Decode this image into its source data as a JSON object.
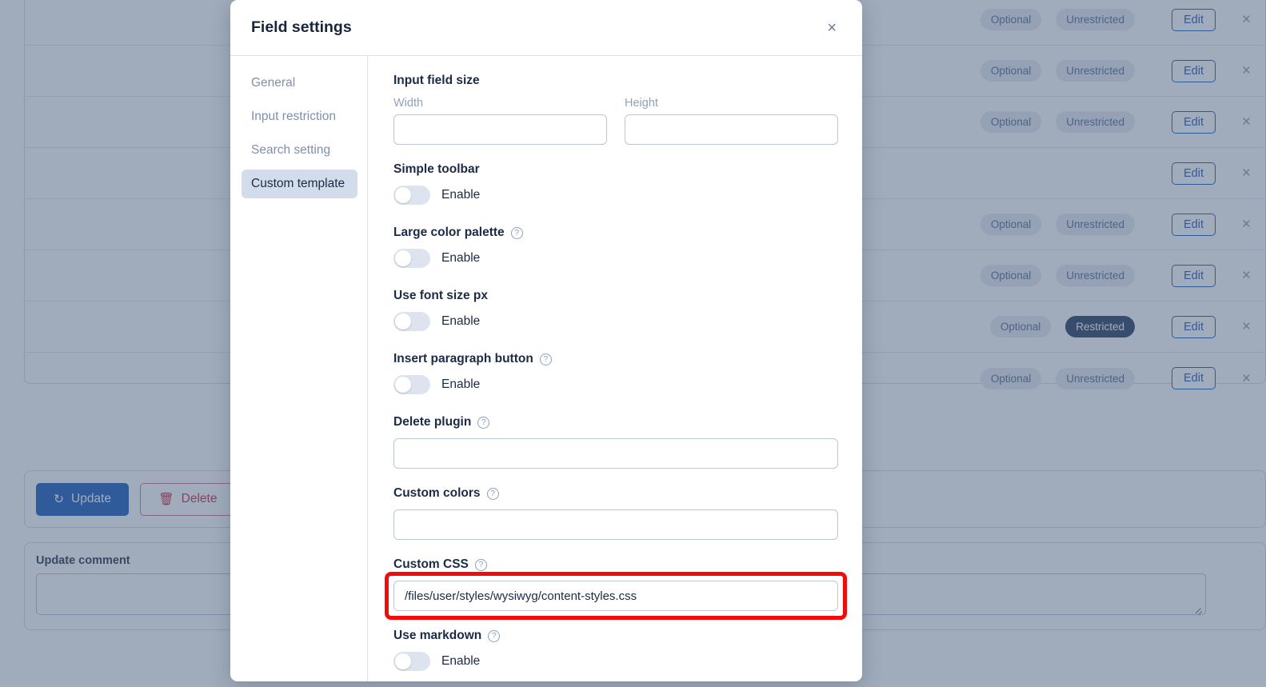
{
  "background": {
    "table_rows": [
      {
        "badges": [
          "Optional",
          "Unrestricted"
        ],
        "edit_label": "Edit",
        "close_icon": "×"
      },
      {
        "badges": [
          "Optional",
          "Unrestricted"
        ],
        "edit_label": "Edit",
        "close_icon": "×"
      },
      {
        "badges": [
          "Optional",
          "Unrestricted"
        ],
        "edit_label": "Edit",
        "close_icon": "×"
      },
      {
        "badges": [
          "",
          ""
        ],
        "edit_label": "Edit",
        "close_icon": "×"
      },
      {
        "badges": [
          "Optional",
          "Unrestricted"
        ],
        "edit_label": "Edit",
        "close_icon": "×"
      },
      {
        "badges": [
          "Optional",
          "Unrestricted"
        ],
        "edit_label": "Edit",
        "close_icon": "×"
      },
      {
        "badges": [
          "Optional",
          "Restricted"
        ],
        "edit_label": "Edit",
        "close_icon": "×"
      },
      {
        "badges": [
          "Optional",
          "Unrestricted"
        ],
        "edit_label": "Edit",
        "close_icon": "×"
      }
    ],
    "actions": {
      "update_label": "Update",
      "update_icon": "↻",
      "delete_label": "Delete",
      "delete_icon": "🗑"
    },
    "comment": {
      "label": "Update comment",
      "value": "",
      "placeholder": ""
    },
    "colors": {
      "primary": "#1f5fbf",
      "danger": "#c4314b",
      "badge_restricted_bg": "#2f4263",
      "overlay": "#8694a5"
    }
  },
  "modal": {
    "title": "Field settings",
    "close_icon": "×",
    "sidebar": {
      "items": [
        {
          "label": "General",
          "active": false
        },
        {
          "label": "Input restriction",
          "active": false
        },
        {
          "label": "Search setting",
          "active": false
        },
        {
          "label": "Custom template",
          "active": true
        }
      ]
    },
    "main": {
      "input_field_size": {
        "title": "Input field size",
        "width": {
          "label": "Width",
          "value": "",
          "placeholder": ""
        },
        "height": {
          "label": "Height",
          "value": "",
          "placeholder": ""
        }
      },
      "toggles": [
        {
          "title": "Simple toolbar",
          "has_help": false,
          "help_icon": "?",
          "enable_label": "Enable",
          "enabled": false
        },
        {
          "title": "Large color palette",
          "has_help": true,
          "help_icon": "?",
          "enable_label": "Enable",
          "enabled": false
        },
        {
          "title": "Use font size px",
          "has_help": false,
          "help_icon": "?",
          "enable_label": "Enable",
          "enabled": false
        },
        {
          "title": "Insert paragraph button",
          "has_help": true,
          "help_icon": "?",
          "enable_label": "Enable",
          "enabled": false
        }
      ],
      "delete_plugin": {
        "title": "Delete plugin",
        "help_icon": "?",
        "value": "",
        "placeholder": ""
      },
      "custom_colors": {
        "title": "Custom colors",
        "help_icon": "?",
        "value": "",
        "placeholder": ""
      },
      "custom_css": {
        "title": "Custom CSS",
        "help_icon": "?",
        "value": "/files/user/styles/wysiwyg/content-styles.css",
        "placeholder": "",
        "highlighted": true,
        "highlight_color": "#f40a0a"
      },
      "use_markdown": {
        "title": "Use markdown",
        "help_icon": "?",
        "enable_label": "Enable",
        "enabled": false
      }
    }
  }
}
